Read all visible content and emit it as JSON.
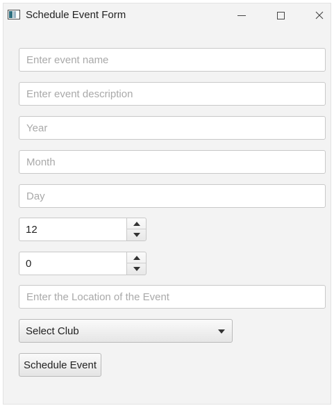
{
  "window": {
    "title": "Schedule Event Form",
    "app_icon": "window-app-icon",
    "controls": [
      "minimize-icon",
      "maximize-icon",
      "close-icon"
    ]
  },
  "form": {
    "event_name_placeholder": "Enter event name",
    "event_description_placeholder": "Enter event description",
    "year_placeholder": "Year",
    "month_placeholder": "Month",
    "day_placeholder": "Day",
    "hour_value": "12",
    "minute_value": "0",
    "location_placeholder": "Enter the Location of the Event",
    "club_select_label": "Select Club",
    "submit_label": "Schedule Event"
  }
}
